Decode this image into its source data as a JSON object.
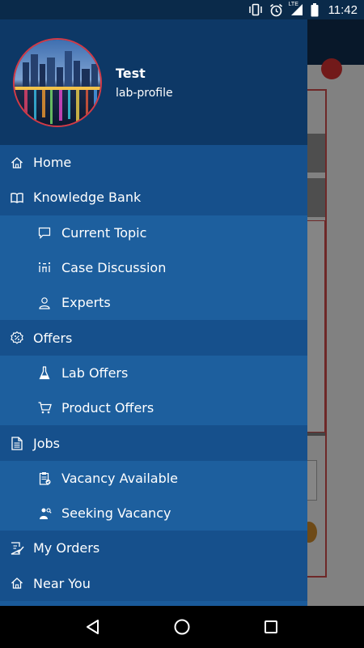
{
  "status_bar": {
    "time": "11:42",
    "network_label": "LTE",
    "icons": [
      "vibrate-icon",
      "alarm-icon",
      "signal-lte-icon",
      "battery-icon"
    ]
  },
  "drawer": {
    "profile": {
      "name": "Test",
      "subtitle": "lab-profile"
    },
    "menu": [
      {
        "label": "Home",
        "icon": "home-icon",
        "level": "top"
      },
      {
        "label": "Knowledge Bank",
        "icon": "book-icon",
        "level": "top"
      },
      {
        "label": "Current Topic",
        "icon": "chat-bubble-icon",
        "level": "sub"
      },
      {
        "label": "Case Discussion",
        "icon": "discussion-icon",
        "level": "sub"
      },
      {
        "label": "Experts",
        "icon": "person-icon",
        "level": "sub"
      },
      {
        "label": "Offers",
        "icon": "percent-badge-icon",
        "level": "top"
      },
      {
        "label": "Lab Offers",
        "icon": "flask-icon",
        "level": "sub"
      },
      {
        "label": "Product Offers",
        "icon": "cart-icon",
        "level": "sub"
      },
      {
        "label": "Jobs",
        "icon": "document-icon",
        "level": "top"
      },
      {
        "label": "Vacancy Available",
        "icon": "clipboard-check-icon",
        "level": "sub"
      },
      {
        "label": "Seeking Vacancy",
        "icon": "job-seeker-icon",
        "level": "sub"
      },
      {
        "label": "My Orders",
        "icon": "orders-icon",
        "level": "top"
      },
      {
        "label": "Near You",
        "icon": "home-icon",
        "level": "top"
      }
    ]
  },
  "colors": {
    "drawer_header": "#0d3866",
    "menu_top": "#16508c",
    "menu_sub": "#1d5f9e",
    "avatar_border": "#d33a46",
    "status_bar": "#0a2a4a"
  },
  "nav_bar": {
    "buttons": [
      "back-icon",
      "home-circle-icon",
      "recents-icon"
    ]
  }
}
